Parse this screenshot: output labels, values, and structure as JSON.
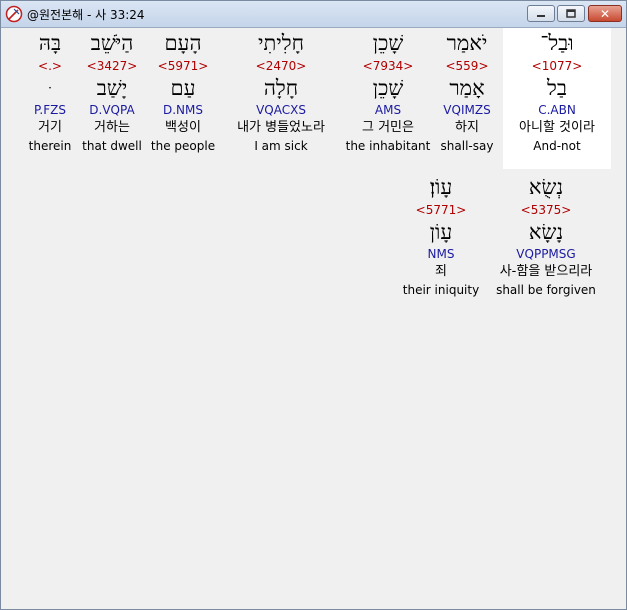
{
  "window": {
    "title": "@원전본해 - 사 33:24",
    "close_glyph": "✕"
  },
  "words": [
    {
      "id": "w1",
      "heb": "וּבַל־",
      "strong": "<1077>",
      "lex": "בַל",
      "morph": "C.ABN",
      "kor": "아니할 것이라",
      "eng": "And-not",
      "selected": true
    },
    {
      "id": "w2",
      "heb": "יֹאמַר",
      "strong": "<559>",
      "lex": "אָמַר",
      "morph": "VQIMZS",
      "kor": "하지",
      "eng": "shall-say",
      "selected": false
    },
    {
      "id": "w3",
      "heb": "שָׁכֵן",
      "strong": "<7934>",
      "lex": "שָׁכֵן",
      "morph": "AMS",
      "kor": "그 거민은",
      "eng": "the inhabitant",
      "selected": false
    },
    {
      "id": "w4",
      "heb": "חָלִיתִי",
      "strong": "<2470>",
      "lex": "חָלָה",
      "morph": "VQACXS",
      "kor": "내가 병들었노라",
      "eng": "I am sick",
      "selected": false
    },
    {
      "id": "w5",
      "heb": "הָעָם",
      "strong": "<5971>",
      "lex": "עַם",
      "morph": "D.NMS",
      "kor": "백성이",
      "eng": "the people",
      "selected": false
    },
    {
      "id": "w6",
      "heb": "הַיֹּשֵׁב",
      "strong": "<3427>",
      "lex": "יָשַׁב",
      "morph": "D.VQPA",
      "kor": "거하는",
      "eng": "that dwell",
      "selected": false
    },
    {
      "id": "w7",
      "heb": "בָּהּ",
      "strong": "<.>",
      "lex": "ּ",
      "morph": "P.FZS",
      "kor": "거기",
      "eng": "therein",
      "selected": false
    },
    {
      "id": "w8",
      "heb": "נְשֻׂא",
      "strong": "<5375>",
      "lex": "נָשָׂא",
      "morph": "VQPPMSG",
      "kor": "사-함을 받으리라",
      "eng": "shall be forgiven",
      "selected": false
    },
    {
      "id": "w9",
      "heb": "עָוֹן׃",
      "strong": "<5771>",
      "lex": "עָוֹן",
      "morph": "NMS",
      "kor": "죄",
      "eng": "their iniquity",
      "selected": false
    }
  ]
}
